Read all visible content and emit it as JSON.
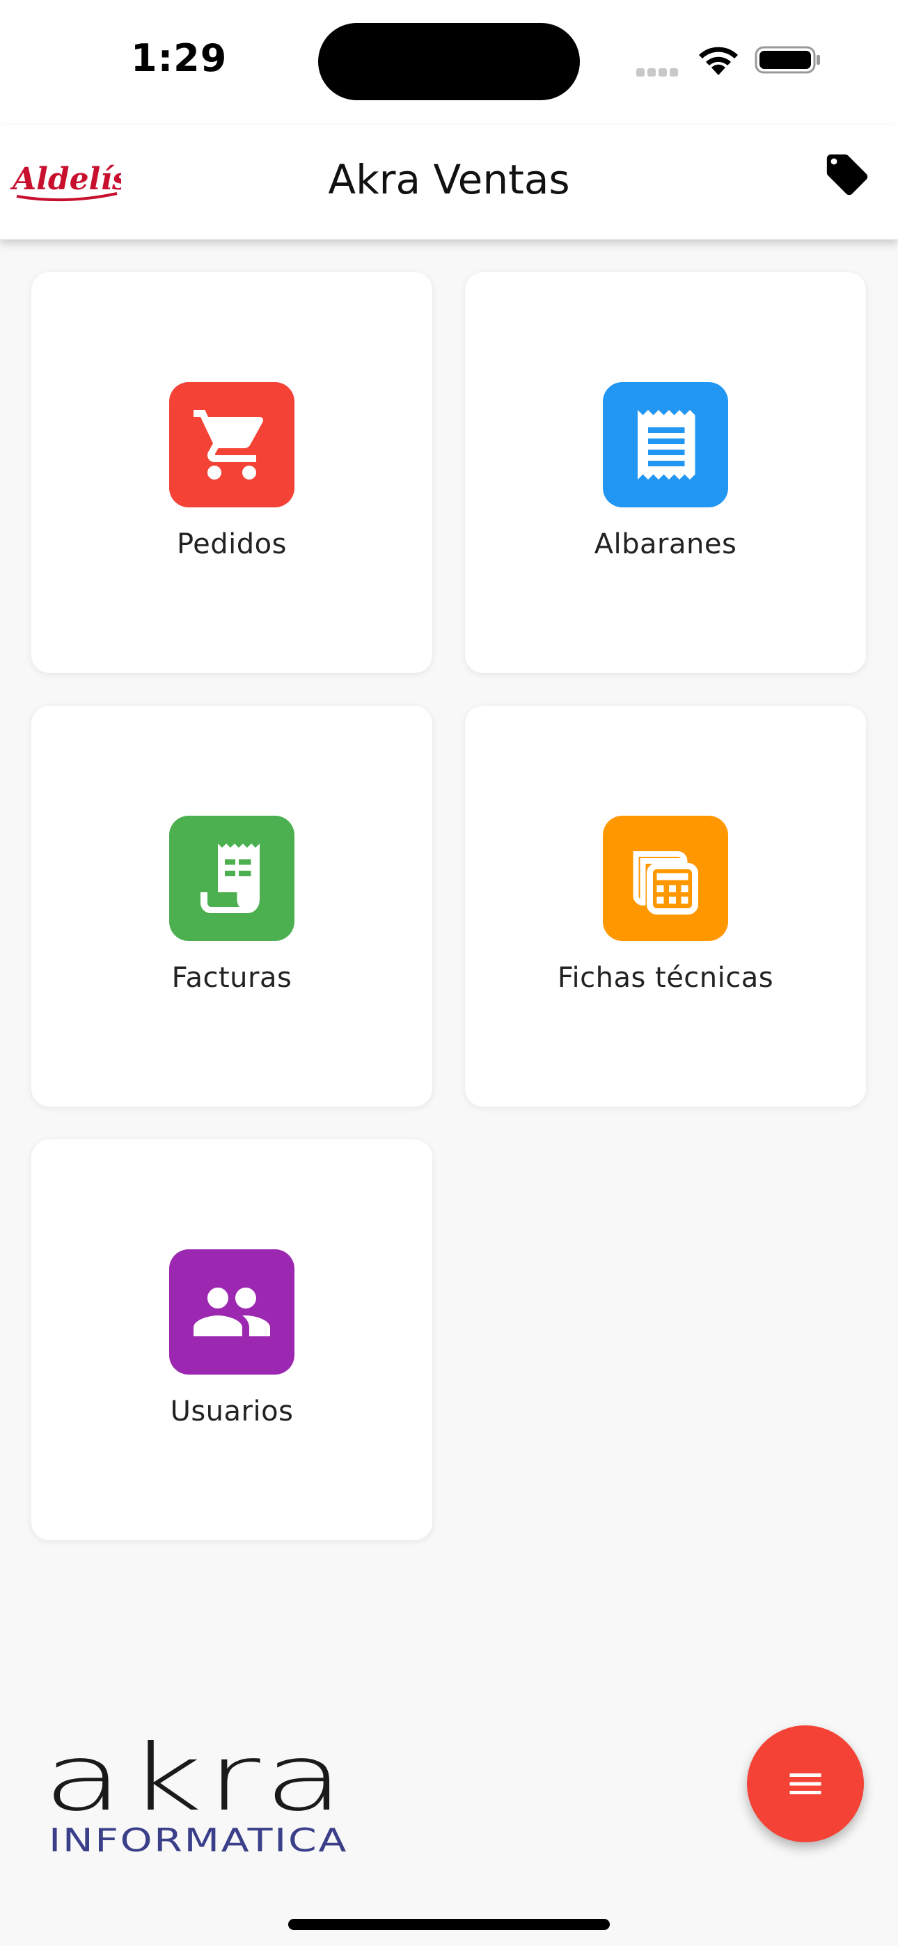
{
  "status_bar": {
    "time": "1:29"
  },
  "app_bar": {
    "brand": "Aldelís",
    "title": "Akra Ventas",
    "action_icon": "tag-icon"
  },
  "menu": {
    "items": [
      {
        "label": "Pedidos",
        "icon": "shopping-cart-icon",
        "color": "#f44336"
      },
      {
        "label": "Albaranes",
        "icon": "receipt-icon",
        "color": "#2196f3"
      },
      {
        "label": "Facturas",
        "icon": "invoice-icon",
        "color": "#4caf50"
      },
      {
        "label": "Fichas técnicas",
        "icon": "calculator-icon",
        "color": "#ff9800"
      },
      {
        "label": "Usuarios",
        "icon": "people-icon",
        "color": "#9c27b0"
      }
    ]
  },
  "footer": {
    "logo_main": "akra",
    "logo_sub": "INFORMATICA"
  },
  "fab": {
    "icon": "menu-icon",
    "color": "#f44336"
  }
}
